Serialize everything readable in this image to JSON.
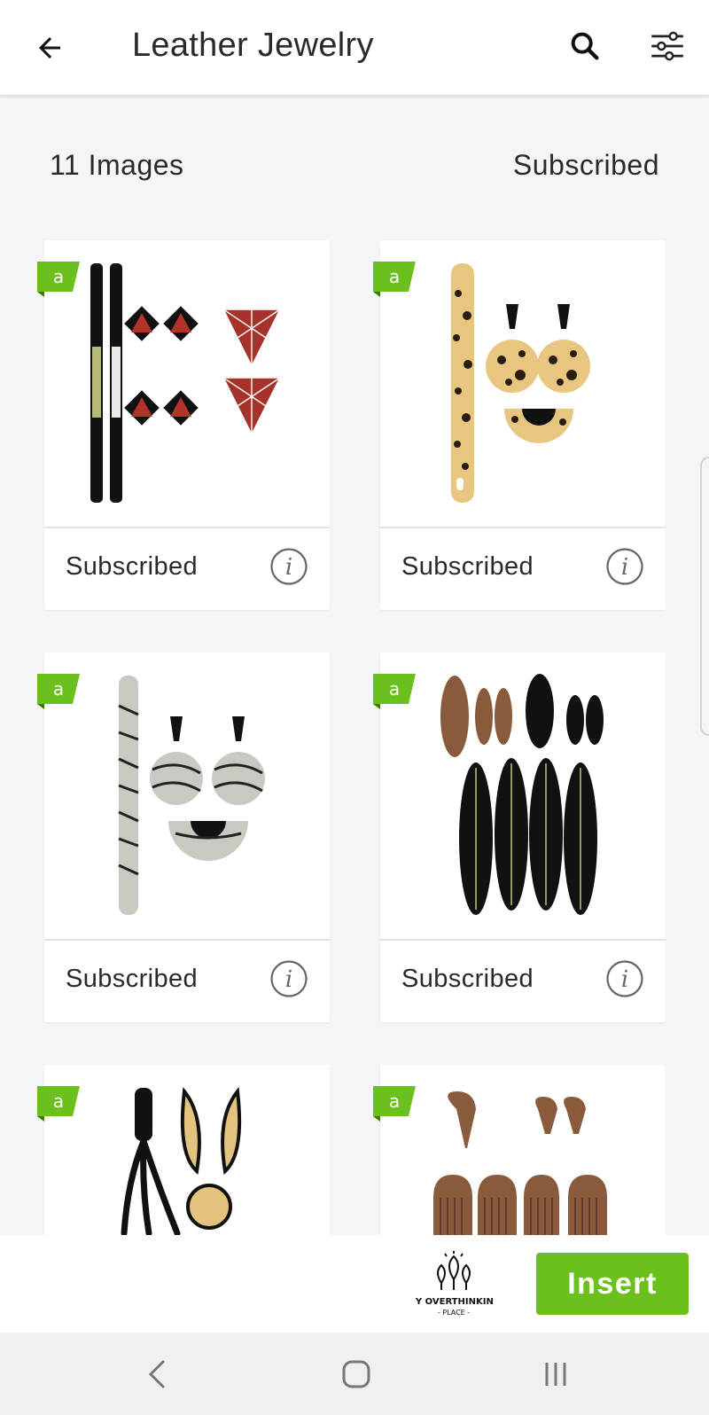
{
  "header": {
    "title": "Leather Jewelry",
    "back_icon": "arrow-left-icon",
    "search_icon": "search-icon",
    "filter_icon": "sliders-icon"
  },
  "summary": {
    "count": "11 Images",
    "filter_status": "Subscribed"
  },
  "cards": [
    {
      "status": "Subscribed",
      "image": "geometric-triangle-earrings-and-bracelet"
    },
    {
      "status": "Subscribed",
      "image": "leopard-print-earrings-and-bracelet"
    },
    {
      "status": "Subscribed",
      "image": "zebra-print-earrings-and-bracelet"
    },
    {
      "status": "Subscribed",
      "image": "feather-earrings"
    },
    {
      "status": "",
      "image": "wing-earrings-and-tassel"
    },
    {
      "status": "",
      "image": "fringe-teardrop-earrings"
    }
  ],
  "bottom_bar": {
    "brand_line1": "MY OVERTHINKING",
    "brand_line2": "- PLACE -",
    "insert_label": "Insert"
  },
  "colors": {
    "accent": "#6cc01e",
    "background": "#f3f5f7",
    "leather_brown": "#8a5a3c",
    "leopard_tan": "#e8c680"
  }
}
